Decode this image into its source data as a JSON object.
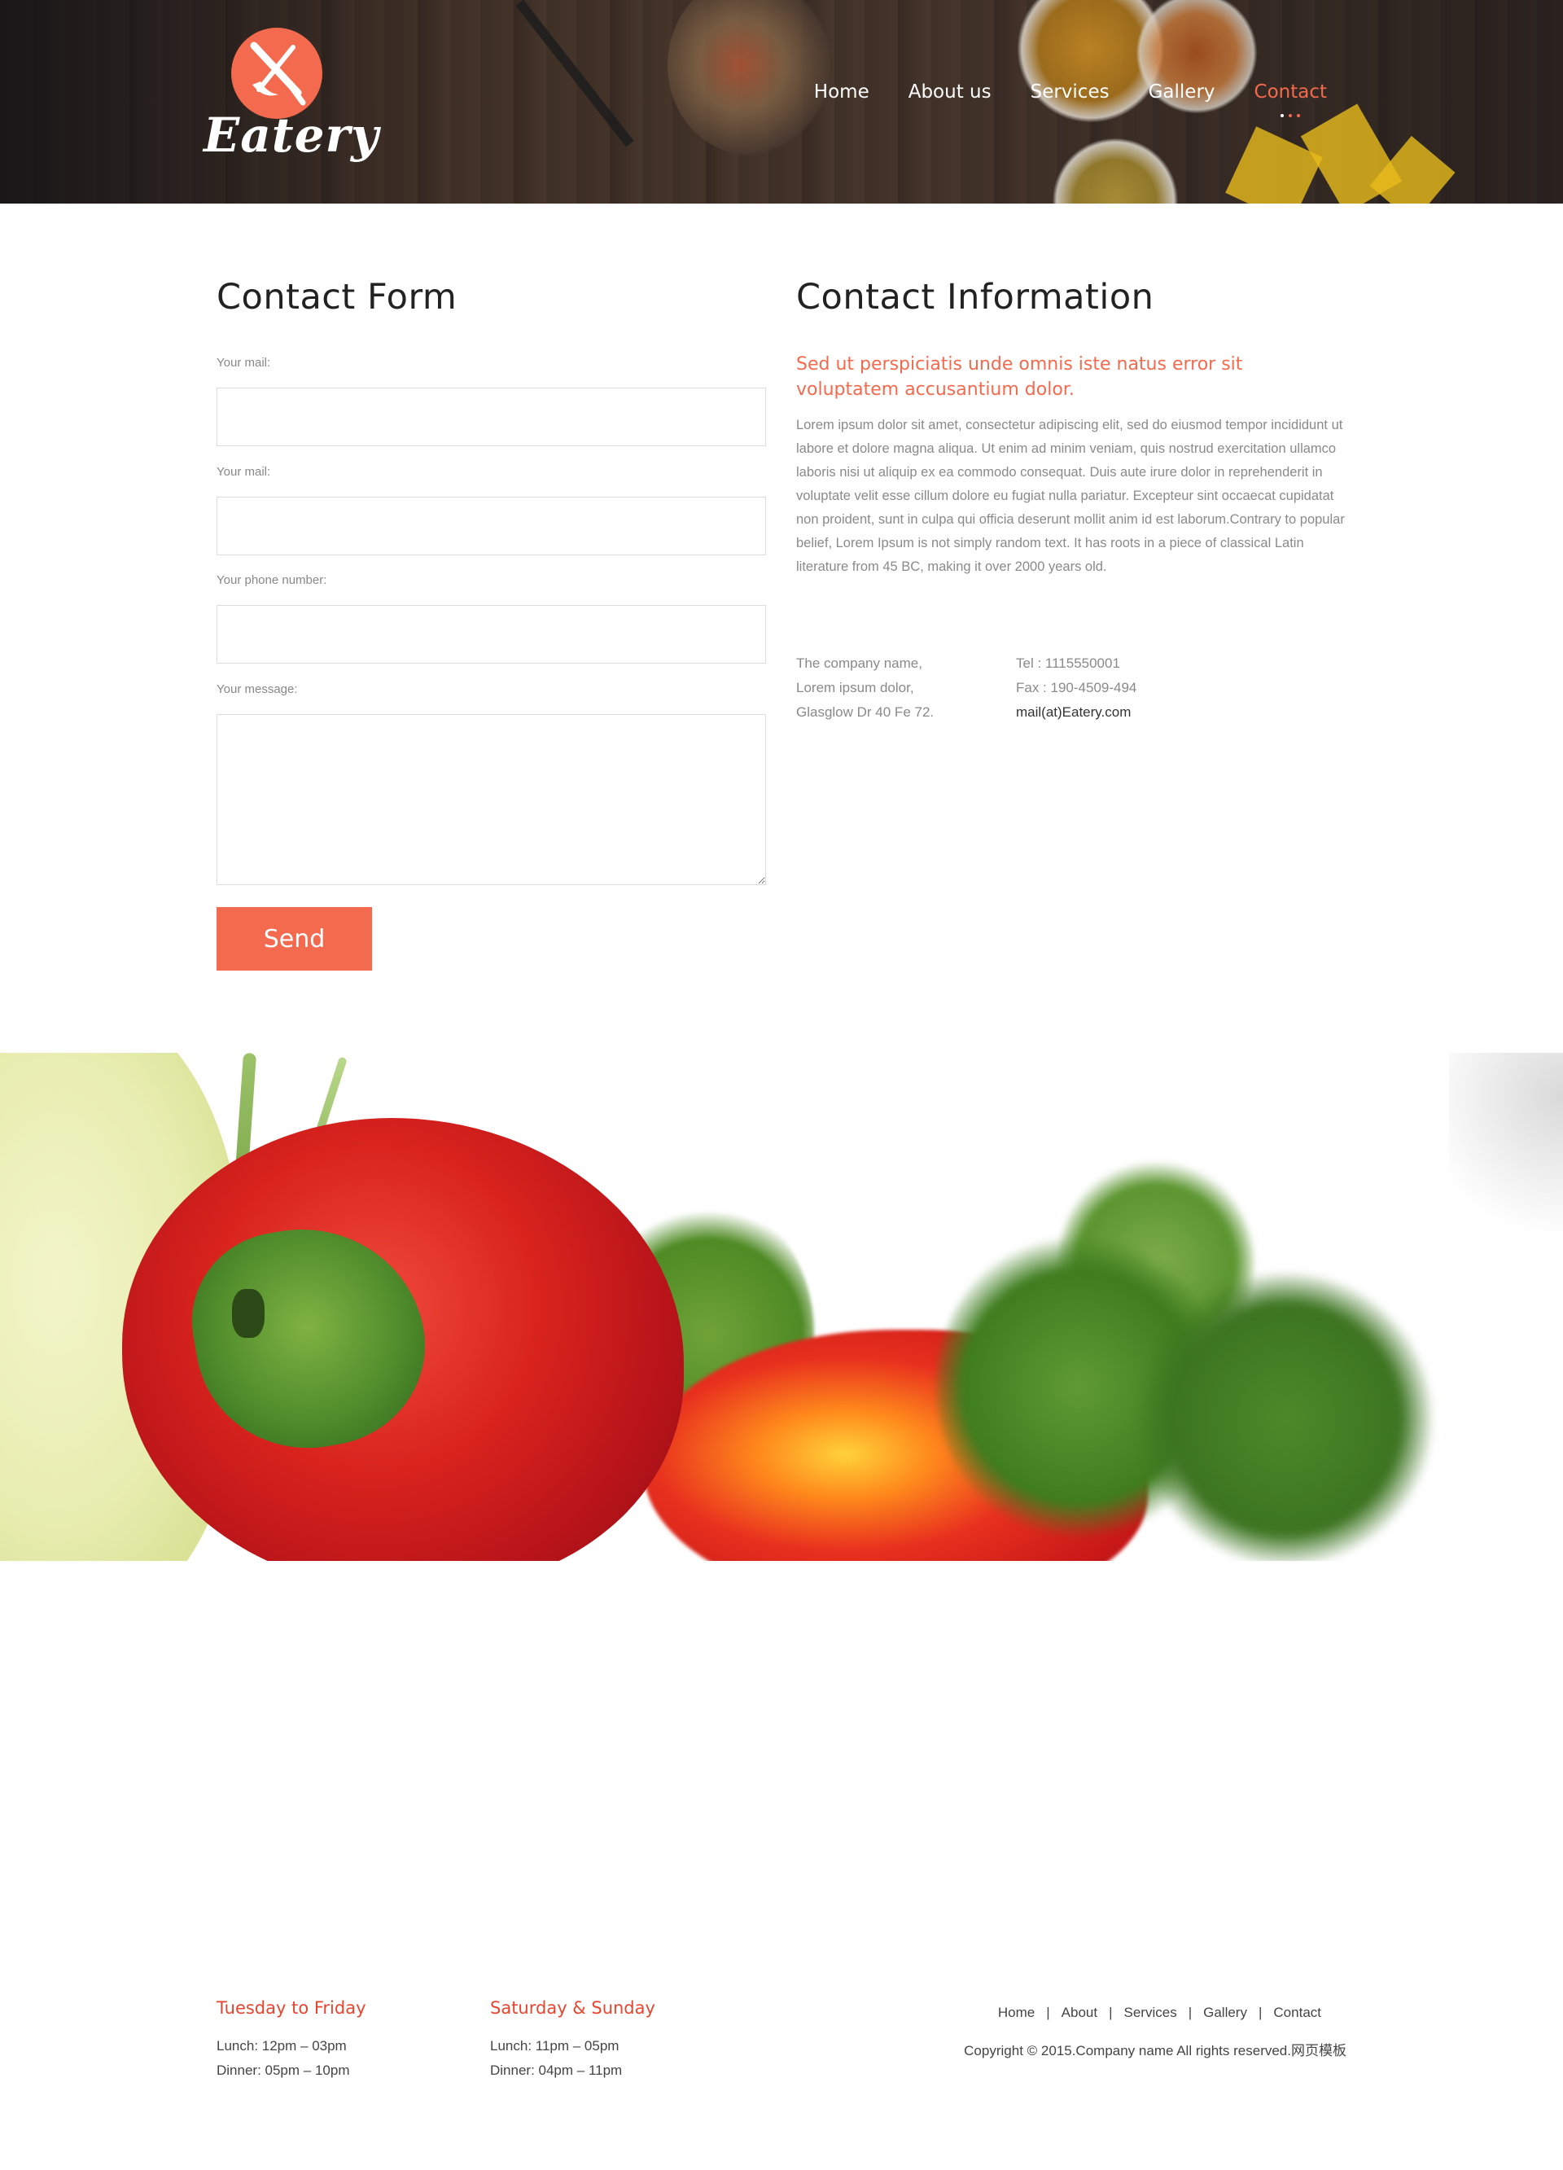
{
  "header": {
    "logo_text": "Eatery",
    "nav": [
      {
        "label": "Home"
      },
      {
        "label": "About us"
      },
      {
        "label": "Services"
      },
      {
        "label": "Gallery"
      },
      {
        "label": "Contact",
        "active": true
      }
    ]
  },
  "contact_form": {
    "title": "Contact Form",
    "fields": [
      {
        "label": "Your mail:",
        "value": ""
      },
      {
        "label": "Your mail:",
        "value": ""
      },
      {
        "label": "Your phone number:",
        "value": ""
      }
    ],
    "message_label": "Your message:",
    "message_value": "",
    "send_label": "Send"
  },
  "contact_info": {
    "title": "Contact Information",
    "lead": "Sed ut perspiciatis unde omnis iste natus error sit voluptatem accusantium dolor.",
    "body": "Lorem ipsum dolor sit amet, consectetur adipiscing elit, sed do eiusmod tempor incididunt ut labore et dolore magna aliqua. Ut enim ad minim veniam, quis nostrud exercitation ullamco laboris nisi ut aliquip ex ea commodo consequat. Duis aute irure dolor in reprehenderit in voluptate velit esse cillum dolore eu fugiat nulla pariatur. Excepteur sint occaecat cupidatat non proident, sunt in culpa qui officia deserunt mollit anim id est laborum.Contrary to popular belief, Lorem Ipsum is not simply random text. It has roots in a piece of classical Latin literature from 45 BC, making it over 2000 years old.",
    "address": [
      "The company name,",
      "Lorem ipsum dolor,",
      "Glasglow Dr 40 Fe 72."
    ],
    "tel": "Tel : 1115550001",
    "fax": "Fax : 190-4509-494",
    "mail": "mail(at)Eatery.com"
  },
  "footer": {
    "hours": [
      {
        "title": "Tuesday to Friday",
        "lunch": "Lunch: 12pm – 03pm",
        "dinner": "Dinner: 05pm – 10pm"
      },
      {
        "title": "Saturday & Sunday",
        "lunch": "Lunch: 11pm – 05pm",
        "dinner": "Dinner: 04pm – 11pm"
      }
    ],
    "nav": [
      "Home",
      "About",
      "Services",
      "Gallery",
      "Contact"
    ],
    "copyright": "Copyright © 2015.Company name All rights reserved.网页模板"
  },
  "colors": {
    "accent": "#f36a4e",
    "footer_title": "#e8452f",
    "header_overlay": "#16161a"
  }
}
